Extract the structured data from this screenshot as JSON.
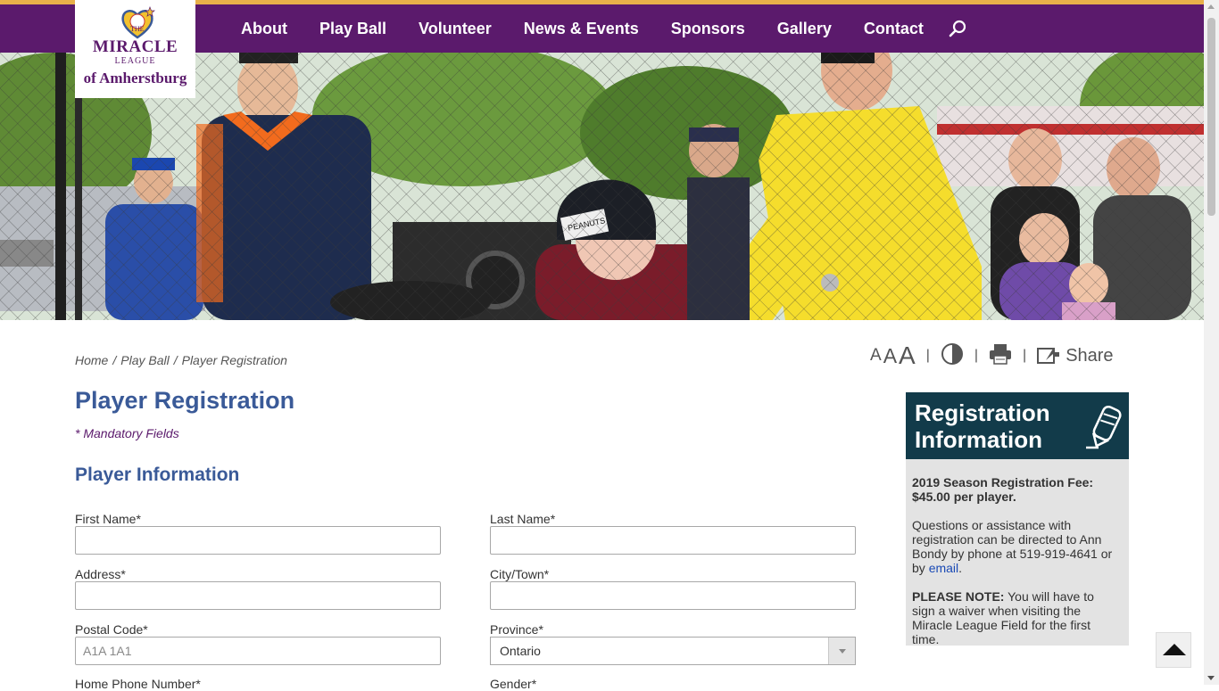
{
  "logo": {
    "line0": "THE",
    "line1": "MIRACLE",
    "line2": "LEAGUE",
    "line3": "of Amherstburg"
  },
  "nav": {
    "items": [
      "About",
      "Play Ball",
      "Volunteer",
      "News & Events",
      "Sponsors",
      "Gallery",
      "Contact"
    ],
    "search_icon": "search-icon"
  },
  "hero": {
    "alt": "hero-photo"
  },
  "breadcrumb": {
    "home": "Home",
    "parent": "Play Ball",
    "current": "Player Registration",
    "separator": "/"
  },
  "tools": {
    "font_small": "A",
    "font_medium": "A",
    "font_large": "A",
    "separator": "|",
    "share_label": "Share"
  },
  "page": {
    "title": "Player Registration",
    "mandatory_note": "* Mandatory Fields",
    "section_title": "Player Information"
  },
  "form": {
    "first_name_label": "First Name*",
    "last_name_label": "Last Name*",
    "address_label": "Address*",
    "city_label": "City/Town*",
    "postal_label": "Postal Code*",
    "postal_placeholder": "A1A 1A1",
    "province_label": "Province*",
    "province_value": "Ontario",
    "home_phone_label": "Home Phone Number*",
    "gender_label": "Gender*"
  },
  "sidebar": {
    "banner_line1": "Registration",
    "banner_line2": "Information",
    "fee_line": "2019 Season Registration Fee: $45.00 per player.",
    "questions_text": "Questions or assistance with registration can be directed to Ann Bondy by phone at 519-919-4641 or by ",
    "email_link": "email",
    "questions_end": ".",
    "note_label": "PLEASE NOTE:",
    "note_text": " You will have to sign a waiver when visiting the Miracle League Field for the first time."
  },
  "colors": {
    "header_purple": "#5b1a6c",
    "accent_gold": "#e8b04a",
    "title_blue": "#3a5a98",
    "banner_teal": "#123b4a"
  }
}
